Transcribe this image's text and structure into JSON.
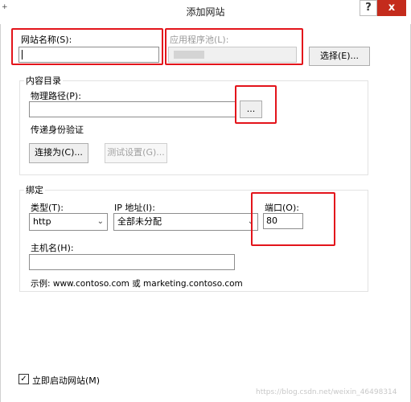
{
  "window": {
    "title": "添加网站",
    "help_glyph": "?",
    "close_glyph": "x",
    "corner_glyph": "+"
  },
  "site_name": {
    "label": "网站名称(S):",
    "value": ""
  },
  "app_pool": {
    "label": "应用程序池(L):",
    "value": "",
    "select_label": "选择(E)..."
  },
  "content_dir": {
    "group_title": "内容目录",
    "physical_path_label": "物理路径(P):",
    "physical_path_value": "",
    "browse_label": "...",
    "pass_through_label": "传递身份验证",
    "connect_as_label": "连接为(C)...",
    "test_settings_label": "测试设置(G)..."
  },
  "binding": {
    "group_title": "绑定",
    "type_label": "类型(T):",
    "type_value": "http",
    "ip_label": "IP 地址(I):",
    "ip_value": "全部未分配",
    "port_label": "端口(O):",
    "port_value": "80",
    "hostname_label": "主机名(H):",
    "hostname_value": "",
    "example_text": "示例: www.contoso.com 或 marketing.contoso.com"
  },
  "start_immediately": {
    "label": "立即启动网站(M)",
    "checked": true,
    "check_glyph": "✓"
  },
  "watermark": "https://blog.csdn.net/weixin_46498314"
}
